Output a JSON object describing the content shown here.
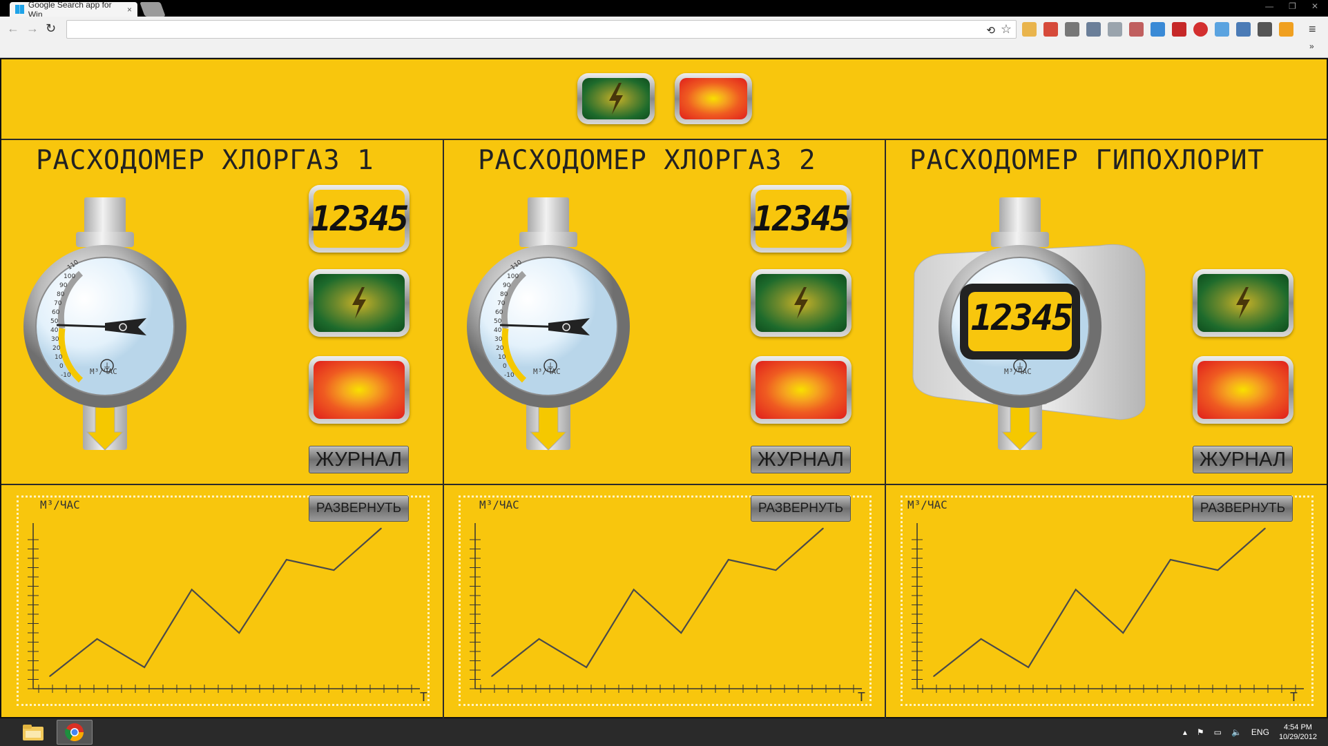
{
  "browser": {
    "tab_title": "Google Search app for Win",
    "tab_close": "×",
    "url": "",
    "win_min": "—",
    "win_max": "❐",
    "win_close": "✕",
    "more_extensions": "»"
  },
  "top_indicators": {
    "lamp_green": "power",
    "lamp_red": "alarm"
  },
  "meters": [
    {
      "title": "РАСХОДОМЕР ХЛОРГАЗ 1",
      "display": "12345",
      "journal": "ЖУРНАЛ",
      "unit": "М³/ЧАС",
      "type": "analog",
      "needle_value": 50,
      "scale": [
        "110",
        "100",
        "90",
        "80",
        "70",
        "60",
        "50",
        "40",
        "30",
        "20",
        "10",
        "0",
        "-10"
      ]
    },
    {
      "title": "РАСХОДОМЕР ХЛОРГАЗ 2",
      "display": "12345",
      "journal": "ЖУРНАЛ",
      "unit": "М³/ЧАС",
      "type": "analog",
      "needle_value": 50,
      "scale": [
        "110",
        "100",
        "90",
        "80",
        "70",
        "60",
        "50",
        "40",
        "30",
        "20",
        "10",
        "0",
        "-10"
      ]
    },
    {
      "title": "РАСХОДОМЕР ГИПОХЛОРИТ",
      "display": "12345",
      "journal": "ЖУРНАЛ",
      "unit": "М³/ЧАС",
      "type": "digital"
    }
  ],
  "charts": [
    {
      "ylabel": "М³/ЧАС",
      "xlabel": "Т",
      "expand": "РАЗВЕРНУТЬ"
    },
    {
      "ylabel": "М³/ЧАС",
      "xlabel": "Т",
      "expand": "РАЗВЕРНУТЬ"
    },
    {
      "ylabel": "М³/ЧАС",
      "xlabel": "Т",
      "expand": "РАЗВЕРНУТЬ"
    }
  ],
  "chart_data": [
    {
      "type": "line",
      "x": [
        1,
        2,
        3,
        4,
        5,
        6,
        7,
        8
      ],
      "values": [
        0,
        2.5,
        0.6,
        5.8,
        2.9,
        7.8,
        7.1,
        9.9
      ],
      "xlabel": "Т",
      "ylabel": "М³/ЧАС",
      "grid": false
    },
    {
      "type": "line",
      "x": [
        1,
        2,
        3,
        4,
        5,
        6,
        7,
        8
      ],
      "values": [
        0,
        2.5,
        0.6,
        5.8,
        2.9,
        7.8,
        7.1,
        9.9
      ],
      "xlabel": "Т",
      "ylabel": "М³/ЧАС",
      "grid": false
    },
    {
      "type": "line",
      "x": [
        1,
        2,
        3,
        4,
        5,
        6,
        7,
        8
      ],
      "values": [
        0,
        2.5,
        0.6,
        5.8,
        2.9,
        7.8,
        7.1,
        9.9
      ],
      "xlabel": "Т",
      "ylabel": "М³/ЧАС",
      "grid": false
    }
  ],
  "taskbar": {
    "language": "ENG",
    "time": "4:54 PM",
    "date": "10/29/2012"
  }
}
